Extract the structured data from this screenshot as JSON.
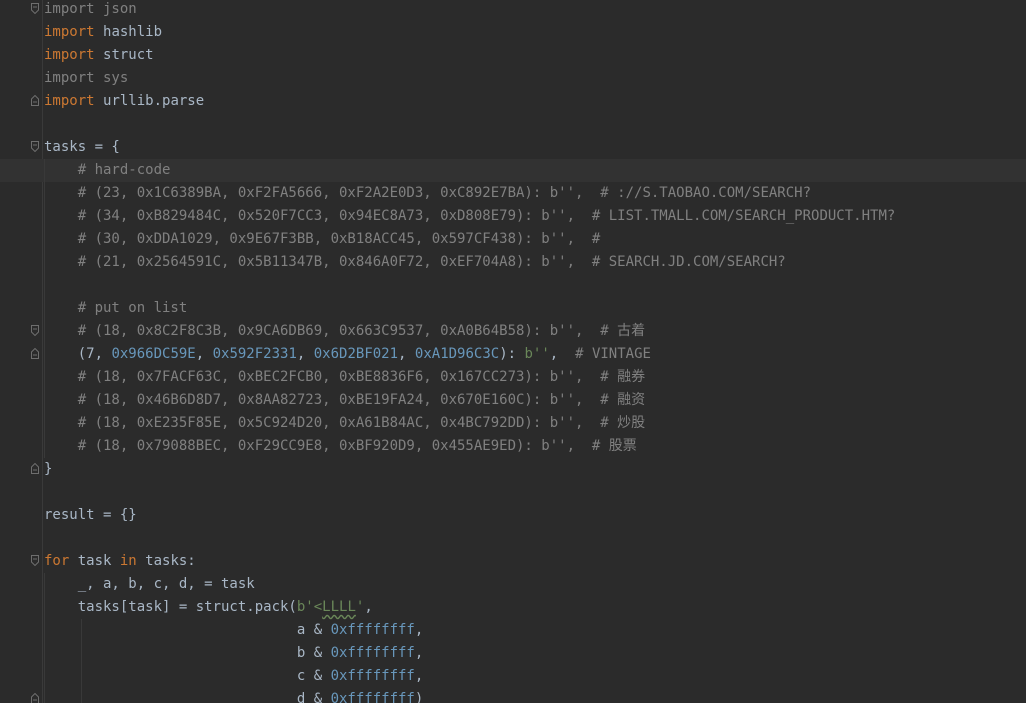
{
  "lines": [
    {
      "id": "l01",
      "parts": [
        [
          "dim",
          "import json"
        ]
      ],
      "fold": "open"
    },
    {
      "id": "l02",
      "parts": [
        [
          "kw",
          "import"
        ],
        [
          "",
          "hashlib"
        ]
      ]
    },
    {
      "id": "l03",
      "parts": [
        [
          "kw",
          "import"
        ],
        [
          "",
          "struct"
        ]
      ]
    },
    {
      "id": "l04",
      "parts": [
        [
          "dim",
          "import sys"
        ]
      ]
    },
    {
      "id": "l05",
      "parts": [
        [
          "kw",
          "import"
        ],
        [
          "",
          "urllib.parse"
        ]
      ],
      "fold": "close"
    },
    {
      "id": "l06",
      "parts": []
    },
    {
      "id": "l07",
      "parts": [
        [
          "",
          "tasks = {"
        ]
      ],
      "fold": "open"
    },
    {
      "id": "l08",
      "parts": [
        [
          "cmt",
          "    # hard-code"
        ]
      ],
      "current": true
    },
    {
      "id": "l09",
      "parts": [
        [
          "cmt",
          "    # (23, 0x1C6389BA, 0xF2FA5666, 0xF2A2E0D3, 0xC892E7BA): b'',  # ://S.TAOBAO.COM/SEARCH?"
        ]
      ]
    },
    {
      "id": "l10",
      "parts": [
        [
          "cmt",
          "    # (34, 0xB829484C, 0x520F7CC3, 0x94EC8A73, 0xD808E79): b'',  # LIST.TMALL.COM/SEARCH_PRODUCT.HTM?"
        ]
      ]
    },
    {
      "id": "l11",
      "parts": [
        [
          "cmt",
          "    # (30, 0xDDA1029, 0x9E67F3BB, 0xB18ACC45, 0x597CF438): b'',  #"
        ]
      ]
    },
    {
      "id": "l12",
      "parts": [
        [
          "cmt",
          "    # (21, 0x2564591C, 0x5B11347B, 0x846A0F72, 0xEF704A8): b'',  # SEARCH.JD.COM/SEARCH?"
        ]
      ]
    },
    {
      "id": "l13",
      "parts": []
    },
    {
      "id": "l14",
      "parts": [
        [
          "cmt",
          "    # put on list"
        ]
      ]
    },
    {
      "id": "l15",
      "parts": [
        [
          "cmt",
          "    # (18, 0x8C2F8C3B, 0x9CA6DB69, 0x663C9537, 0xA0B64B58): b'',  # 古着"
        ]
      ],
      "fold": "open"
    },
    {
      "id": "l16",
      "parts": [
        [
          "",
          "    (7, "
        ],
        [
          "num",
          "0x966DC59E"
        ],
        [
          "",
          ", "
        ],
        [
          "num",
          "0x592F2331"
        ],
        [
          "",
          ", "
        ],
        [
          "num",
          "0x6D2BF021"
        ],
        [
          "",
          ", "
        ],
        [
          "num",
          "0xA1D96C3C"
        ],
        [
          "",
          "): "
        ],
        [
          "str",
          "b''"
        ],
        [
          "",
          ",  "
        ],
        [
          "cmt",
          "# VINTAGE"
        ]
      ],
      "fold": "close"
    },
    {
      "id": "l17",
      "parts": [
        [
          "cmt",
          "    # (18, 0x7FACF63C, 0xBEC2FCB0, 0xBE8836F6, 0x167CC273): b'',  # 融券"
        ]
      ]
    },
    {
      "id": "l18",
      "parts": [
        [
          "cmt",
          "    # (18, 0x46B6D8D7, 0x8AA82723, 0xBE19FA24, 0x670E160C): b'',  # 融资"
        ]
      ]
    },
    {
      "id": "l19",
      "parts": [
        [
          "cmt",
          "    # (18, 0xE235F85E, 0x5C924D20, 0xA61B84AC, 0x4BC792DD): b'',  # 炒股"
        ]
      ]
    },
    {
      "id": "l20",
      "parts": [
        [
          "cmt",
          "    # (18, 0x79088BEC, 0xF29CC9E8, 0xBF920D9, 0x455AE9ED): b'',  # 股票"
        ]
      ]
    },
    {
      "id": "l21",
      "parts": [
        [
          "",
          "}"
        ]
      ],
      "fold": "close"
    },
    {
      "id": "l22",
      "parts": []
    },
    {
      "id": "l23",
      "parts": [
        [
          "",
          "result = {}"
        ]
      ]
    },
    {
      "id": "l24",
      "parts": []
    },
    {
      "id": "l25",
      "parts": [
        [
          "kw",
          "for"
        ],
        [
          "",
          " task "
        ],
        [
          "kw",
          "in"
        ],
        [
          "",
          " tasks:"
        ]
      ],
      "fold": "open"
    },
    {
      "id": "l26",
      "parts": [
        [
          "",
          "    _, a, b, c, d, = task"
        ]
      ]
    },
    {
      "id": "l27",
      "parts": [
        [
          "",
          "    tasks[task] = struct.pack("
        ],
        [
          "str",
          "b'<"
        ],
        [
          "str wavy",
          "LLLL"
        ],
        [
          "str",
          "'"
        ],
        [
          "",
          ","
        ]
      ]
    },
    {
      "id": "l28",
      "parts": [
        [
          "",
          "                              a & "
        ],
        [
          "num",
          "0xffffffff"
        ],
        [
          "",
          ","
        ]
      ]
    },
    {
      "id": "l29",
      "parts": [
        [
          "",
          "                              b & "
        ],
        [
          "num",
          "0xffffffff"
        ],
        [
          "",
          ","
        ]
      ]
    },
    {
      "id": "l30",
      "parts": [
        [
          "",
          "                              c & "
        ],
        [
          "num",
          "0xffffffff"
        ],
        [
          "",
          ","
        ]
      ]
    },
    {
      "id": "l31",
      "parts": [
        [
          "",
          "                              d & "
        ],
        [
          "num",
          "0xffffffff"
        ],
        [
          "",
          ")"
        ]
      ],
      "fold": "close"
    }
  ]
}
